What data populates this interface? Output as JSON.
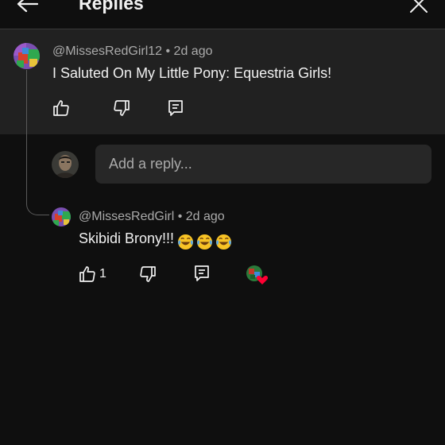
{
  "header": {
    "title": "Replies",
    "back_icon": "arrow-left-icon",
    "close_icon": "close-icon"
  },
  "parent_comment": {
    "meta": "@MissesRedGirl12 • 2d ago",
    "text": "I Saluted On My Little Pony: Equestria Girls!",
    "icons": [
      "thumbs-up-icon",
      "thumbs-down-icon",
      "reply-icon"
    ]
  },
  "reply_box": {
    "placeholder": "Add a reply..."
  },
  "reply": {
    "meta": "@MissesRedGirl • 2d ago",
    "text": "Skibidi Brony!!!",
    "emojis": [
      "face-with-tears-of-joy",
      "face-with-tears-of-joy",
      "face-with-tears-of-joy"
    ],
    "like_count": "1",
    "icons": [
      "thumbs-up-icon",
      "thumbs-down-icon",
      "reply-icon",
      "creator-heart-icon"
    ]
  },
  "colors": {
    "background": "#0f0f0f",
    "panel": "#212121",
    "input": "#272727",
    "text_primary": "#f1f1f1",
    "text_secondary": "#aaaaaa",
    "heart": "#ff0033"
  }
}
